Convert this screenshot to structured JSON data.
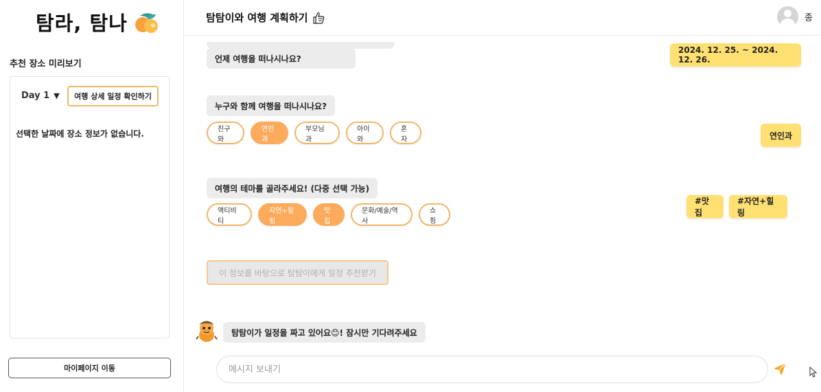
{
  "sidebar": {
    "logo_text": "탐라, 탐나",
    "preview_title": "추천 장소 미리보기",
    "day_label": "Day 1",
    "detail_button": "여행 상세 일정 확인하기",
    "empty_message": "선택한 날짜에 장소 정보가 없습니다.",
    "mypage_button": "마이페이지 이동"
  },
  "header": {
    "title": "탐탐이와 여행 계획하기",
    "user_name": "종"
  },
  "chat": {
    "q_when": "언제 여행을 떠나시나요?",
    "a_when": "2024. 12. 25. ~ 2024. 12. 26.",
    "q_with": "누구와 함께 여행을 떠나시나요?",
    "with_options": [
      "친구와",
      "연인과",
      "부모님과",
      "아이와",
      "혼자"
    ],
    "with_selected": "연인과",
    "a_with": "연인과",
    "q_theme": "여행의 테마를 골라주세요! (다중 선택 가능)",
    "theme_options": [
      "액티비티",
      "자연+힐링",
      "맛집",
      "문화/예술/역사",
      "쇼핑"
    ],
    "theme_selected": [
      "자연+힐링",
      "맛집"
    ],
    "a_theme": [
      "#맛집",
      "#자연+힐링"
    ],
    "recommend_button": "이 정보를 바탕으로 탐탐이에게 일정 추천받기",
    "status_message": "탐탐이가 일정을 짜고 있어요😊! 잠시만 기다려주세요",
    "input_placeholder": "메시지 보내기"
  },
  "colors": {
    "accent_orange": "#fbab5b",
    "chip_border": "#f3b569",
    "user_bubble": "#ffe073",
    "bot_bubble": "#ececec"
  },
  "icons": {
    "logo": "tangerine-icon",
    "title": "thumbs-up-icon",
    "send": "paper-plane-icon"
  }
}
